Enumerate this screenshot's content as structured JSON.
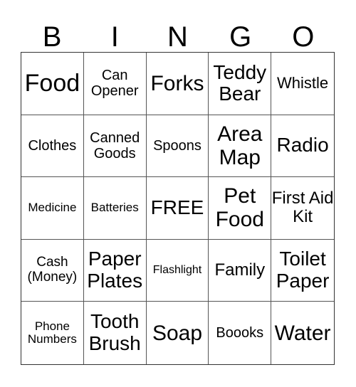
{
  "header": {
    "letters": [
      "B",
      "I",
      "N",
      "G",
      "O"
    ]
  },
  "card": {
    "rows": [
      [
        "Food",
        "Can Opener",
        "Forks",
        "Teddy Bear",
        "Whistle"
      ],
      [
        "Clothes",
        "Canned Goods",
        "Spoons",
        "Area Map",
        "Radio"
      ],
      [
        "Medicine",
        "Batteries",
        "FREE",
        "Pet Food",
        "First Aid Kit"
      ],
      [
        "Cash (Money)",
        "Paper Plates",
        "Flashlight",
        "Family",
        "Toilet Paper"
      ],
      [
        "Phone Numbers",
        "Tooth Brush",
        "Soap",
        "Boooks",
        "Water"
      ]
    ]
  }
}
